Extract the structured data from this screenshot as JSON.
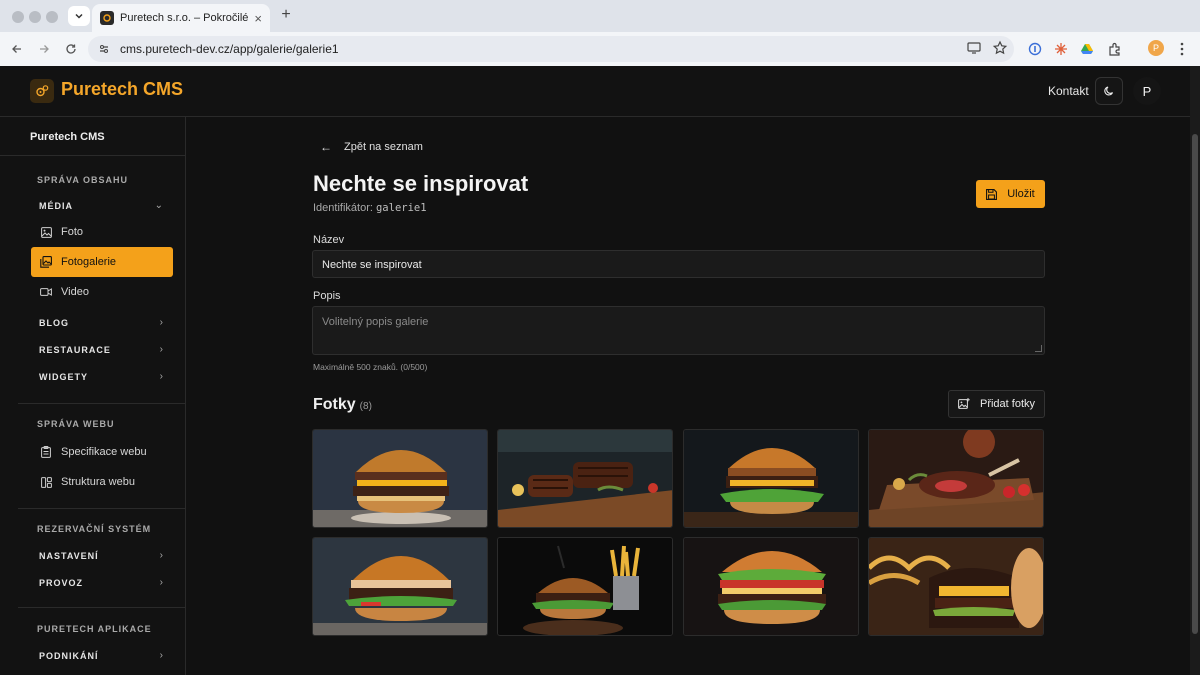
{
  "browser": {
    "tab_title": "Puretech s.r.o. – Pokročilé w",
    "url": "cms.puretech-dev.cz/app/galerie/galerie1",
    "profile_initial": "P"
  },
  "header": {
    "logo_text": "Puretech CMS",
    "contact": "Kontakt",
    "avatar_initial": "P",
    "accent": "#f4a11a"
  },
  "sidebar": {
    "title": "Puretech CMS",
    "sections": {
      "content": "SPRÁVA OBSAHU",
      "web": "SPRÁVA WEBU",
      "reservation": "REZERVAČNÍ SYSTÉM",
      "apps": "PURETECH APLIKACE"
    },
    "groups": {
      "media": "MÉDIA",
      "blog": "BLOG",
      "restaurace": "RESTAURACE",
      "widgety": "WIDGETY",
      "nastaveni": "NASTAVENÍ",
      "provoz": "PROVOZ",
      "podnikani": "PODNIKÁNÍ"
    },
    "items": {
      "foto": "Foto",
      "fotogalerie": "Fotogalerie",
      "video": "Video",
      "specifikace": "Specifikace webu",
      "struktura": "Struktura webu"
    }
  },
  "main": {
    "back": "Zpět na seznam",
    "title": "Nechte se inspirovat",
    "identifier_label": "Identifikátor:",
    "identifier_value": "galerie1",
    "save": "Uložit",
    "name_label": "Název",
    "name_value": "Nechte se inspirovat",
    "desc_label": "Popis",
    "desc_placeholder": "Volitelný popis galerie",
    "desc_hint": "Maximálně 500 znaků. (0/500)",
    "photos_title": "Fotky",
    "photos_count": "(8)",
    "add_photos": "Přidat fotky"
  }
}
